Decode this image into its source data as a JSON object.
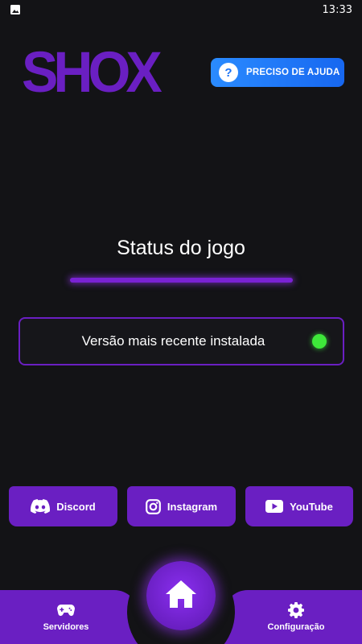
{
  "status_bar": {
    "time": "13:33",
    "notification_icon": "image-icon"
  },
  "header": {
    "logo_text": "SHOX",
    "help_button": {
      "label": "PRECISO DE AJUDA",
      "icon": "question-icon",
      "icon_glyph": "?"
    }
  },
  "game_status": {
    "title": "Status do jogo",
    "message": "Versão mais recente instalada",
    "indicator_color": "#3ee83a"
  },
  "social": [
    {
      "label": "Discord",
      "icon": "discord-icon"
    },
    {
      "label": "Instagram",
      "icon": "instagram-icon"
    },
    {
      "label": "YouTube",
      "icon": "youtube-icon"
    }
  ],
  "bottom_nav": {
    "left": {
      "label": "Servidores",
      "icon": "gamepad-icon"
    },
    "center": {
      "icon": "home-icon"
    },
    "right": {
      "label": "Configuração",
      "icon": "gear-icon"
    }
  },
  "colors": {
    "background": "#131316",
    "accent_purple": "#6a1fc2",
    "help_blue": "#1a72f5",
    "status_green": "#3ee83a"
  }
}
